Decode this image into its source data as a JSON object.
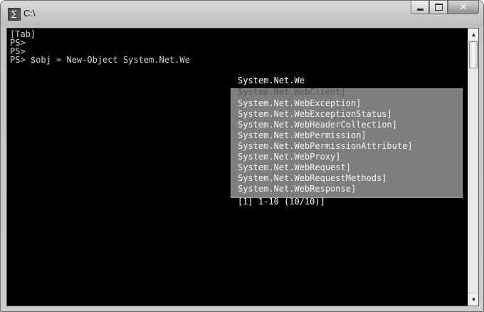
{
  "window": {
    "title": "C:\\",
    "icon": "powershell-icon",
    "buttons": {
      "minimize": "minimize-icon",
      "maximize": "maximize-icon",
      "close": "✕"
    }
  },
  "console": {
    "lines": [
      "[Tab]",
      "PS>",
      "PS>",
      "PS> $obj = New-Object System.Net.We"
    ],
    "completion_current": "System.Net.We",
    "popup_ghost": "System.Net.WebClient]",
    "popup_items": [
      "System.Net.WebException]",
      "System.Net.WebExceptionStatus]",
      "System.Net.WebHeaderCollection]",
      "System.Net.WebPermission]",
      "System.Net.WebPermissionAttribute]",
      "System.Net.WebProxy]",
      "System.Net.WebRequest]",
      "System.Net.WebRequestMethods]",
      "System.Net.WebResponse]"
    ],
    "popup_footer": "[1] 1-10 (10/10)]"
  },
  "scrollbar": {
    "up_icon": "scroll-up-icon",
    "down_icon": "scroll-down-icon"
  }
}
